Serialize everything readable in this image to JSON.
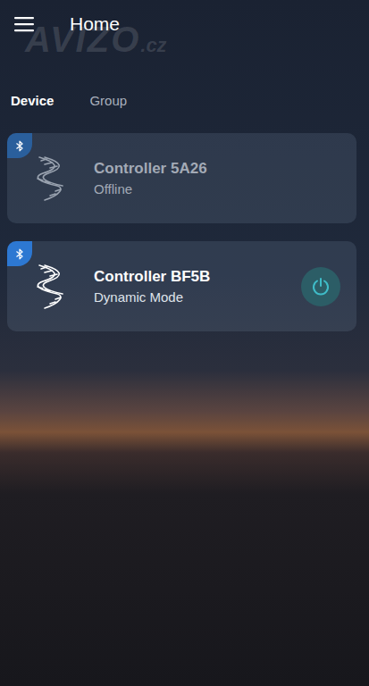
{
  "header": {
    "menu_icon": "☰",
    "title": "Home"
  },
  "watermark": {
    "brand": "AVIZO",
    "suffix": ".cz"
  },
  "tabs": [
    {
      "label": "Device",
      "selected": true
    },
    {
      "label": "Group",
      "selected": false
    }
  ],
  "devices": [
    {
      "name": "Controller 5A26",
      "status": "Offline",
      "online": false
    },
    {
      "name": "Controller BF5B",
      "status": "Dynamic Mode",
      "online": true
    }
  ]
}
